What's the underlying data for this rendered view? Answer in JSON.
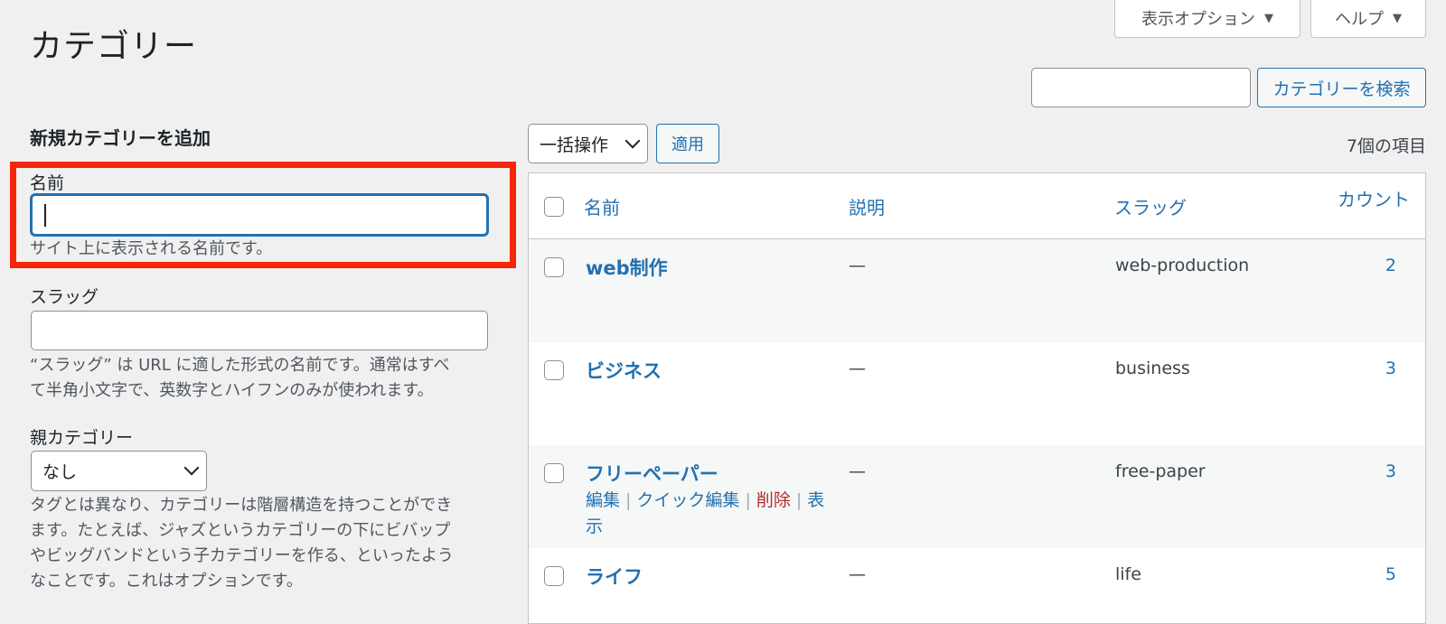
{
  "header": {
    "page_title": "カテゴリー",
    "screen_options": "表示オプション",
    "help": "ヘルプ",
    "tri": "▼"
  },
  "search": {
    "button_label": "カテゴリーを検索",
    "value": ""
  },
  "form": {
    "title": "新規カテゴリーを追加",
    "name_label": "名前",
    "name_hint": "サイト上に表示される名前です。",
    "slug_label": "スラッグ",
    "slug_hint_1": "“スラッグ” は URL に適した形式の名前です。通常はすべ",
    "slug_hint_2": "て半角小文字で、英数字とハイフンのみが使われます。",
    "parent_label": "親カテゴリー",
    "parent_selected": "なし",
    "parent_hint_1": "タグとは異なり、カテゴリーは階層構造を持つことができ",
    "parent_hint_2": "ます。たとえば、ジャズというカテゴリーの下にビバップ",
    "parent_hint_3": "やビッグバンドという子カテゴリーを作る、といったよう",
    "parent_hint_4": "なことです。これはオプションです。"
  },
  "toolbar": {
    "bulk_selected": "一括操作",
    "apply_label": "適用",
    "item_count": "7個の項目"
  },
  "table": {
    "columns": [
      "名前",
      "説明",
      "スラッグ",
      "カウント"
    ],
    "rows": [
      {
        "name": "web制作",
        "description": "—",
        "slug": "web-production",
        "count": "2"
      },
      {
        "name": "ビジネス",
        "description": "—",
        "slug": "business",
        "count": "3"
      },
      {
        "name": "フリーペーパー",
        "description": "—",
        "slug": "free-paper",
        "count": "3"
      },
      {
        "name": "ライフ",
        "description": "—",
        "slug": "life",
        "count": "5"
      }
    ],
    "row_actions": {
      "edit": "編集",
      "quick_edit": "クイック編集",
      "delete": "削除",
      "view_1": "表",
      "view_2": "示",
      "sep": "|"
    }
  }
}
